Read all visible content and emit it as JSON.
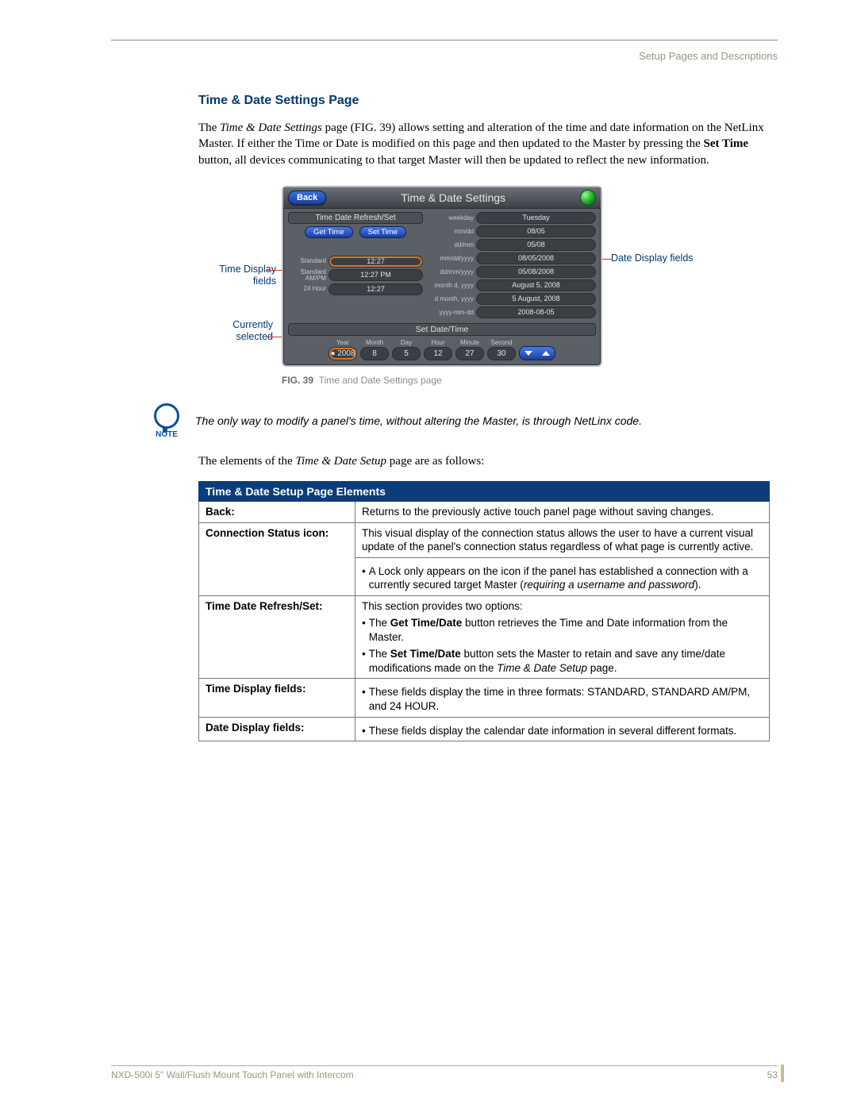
{
  "header_right": "Setup Pages and Descriptions",
  "section_title": "Time & Date Settings Page",
  "intro_parts": {
    "a": "The ",
    "b_italic": "Time & Date Settings",
    "c": " page (FIG. 39) allows setting and alteration of the time and date information on the NetLinx Master. If either the Time or Date is modified on this page and then updated to the Master by pressing the ",
    "d_bold": "Set Time",
    "e": " button, all devices communicating to that target Master will then be updated to reflect the new information."
  },
  "callouts": {
    "time_display": "Time Display fields",
    "currently_selected": "Currently selected",
    "date_display": "Date Display fields"
  },
  "panel": {
    "back": "Back",
    "title": "Time & Date Settings",
    "refresh_header": "Time Date Refresh/Set",
    "get_time": "Get Time",
    "set_time": "Set Time",
    "time_rows": [
      {
        "label": "Standard",
        "value": "12:27"
      },
      {
        "label": "Standard AM/PM",
        "value": "12:27 PM"
      },
      {
        "label": "24 Hour",
        "value": "12:27"
      }
    ],
    "date_rows": [
      {
        "label": "weekday",
        "value": "Tuesday"
      },
      {
        "label": "mm/dd",
        "value": "08/05"
      },
      {
        "label": "dd/mm",
        "value": "05/08"
      },
      {
        "label": "mm/dd/yyyy",
        "value": "08/05/2008"
      },
      {
        "label": "dd/mm/yyyy",
        "value": "05/08/2008"
      },
      {
        "label": "month d, yyyy",
        "value": "August 5, 2008"
      },
      {
        "label": "d month, yyyy",
        "value": "5 August, 2008"
      },
      {
        "label": "yyyy-mm-dd",
        "value": "2008-08-05"
      }
    ],
    "set_banner": "Set Date/Time",
    "spinners": [
      {
        "label": "Year",
        "value": "2008",
        "selected": true
      },
      {
        "label": "Month",
        "value": "8"
      },
      {
        "label": "Day",
        "value": "5"
      },
      {
        "label": "Hour",
        "value": "12"
      },
      {
        "label": "Minute",
        "value": "27"
      },
      {
        "label": "Second",
        "value": "30"
      }
    ]
  },
  "fig_caption_bold": "FIG. 39",
  "fig_caption_text": "Time and Date Settings page",
  "note_label": "NOTE",
  "note_text": "The only way to modify a panel's time, without altering the Master, is through NetLinx code.",
  "follow_parts": {
    "a": "The elements of the ",
    "b_italic": "Time & Date Setup",
    "c": " page are as follows:"
  },
  "table_header": "Time & Date Setup Page Elements",
  "table_rows": [
    {
      "label": "Back:",
      "lines": [
        "Returns to the previously active touch panel page without saving changes."
      ]
    }
  ],
  "row_conn": {
    "label": "Connection Status icon:",
    "para": "This visual display of the connection status allows the user to have a current visual update of the panel's connection status regardless of what page is currently active.",
    "bullet_a": "A Lock only appears on the icon if the panel has established a connection with a currently secured target Master (",
    "bullet_b_italic": "requiring a username and password",
    "bullet_c": ")."
  },
  "row_refresh": {
    "label": "Time Date Refresh/Set:",
    "intro": "This section provides two options:",
    "b1_a": "The ",
    "b1_bold": "Get Time/Date",
    "b1_c": " button retrieves the Time and Date information from the Master.",
    "b2_a": "The ",
    "b2_bold": "Set Time/Date",
    "b2_c": " button sets the Master to retain and save any time/date modifications made on the ",
    "b2_d_italic": "Time & Date Setup",
    "b2_e": " page."
  },
  "row_timefields": {
    "label": "Time Display fields:",
    "bullet": "These fields display the time in three formats: STANDARD, STANDARD AM/PM, and 24 HOUR."
  },
  "row_datefields": {
    "label": "Date Display fields:",
    "bullet": "These fields display the calendar date information in several different formats."
  },
  "footer_left": "NXD-500i 5\" Wall/Flush Mount Touch Panel with Intercom",
  "footer_right": "53"
}
